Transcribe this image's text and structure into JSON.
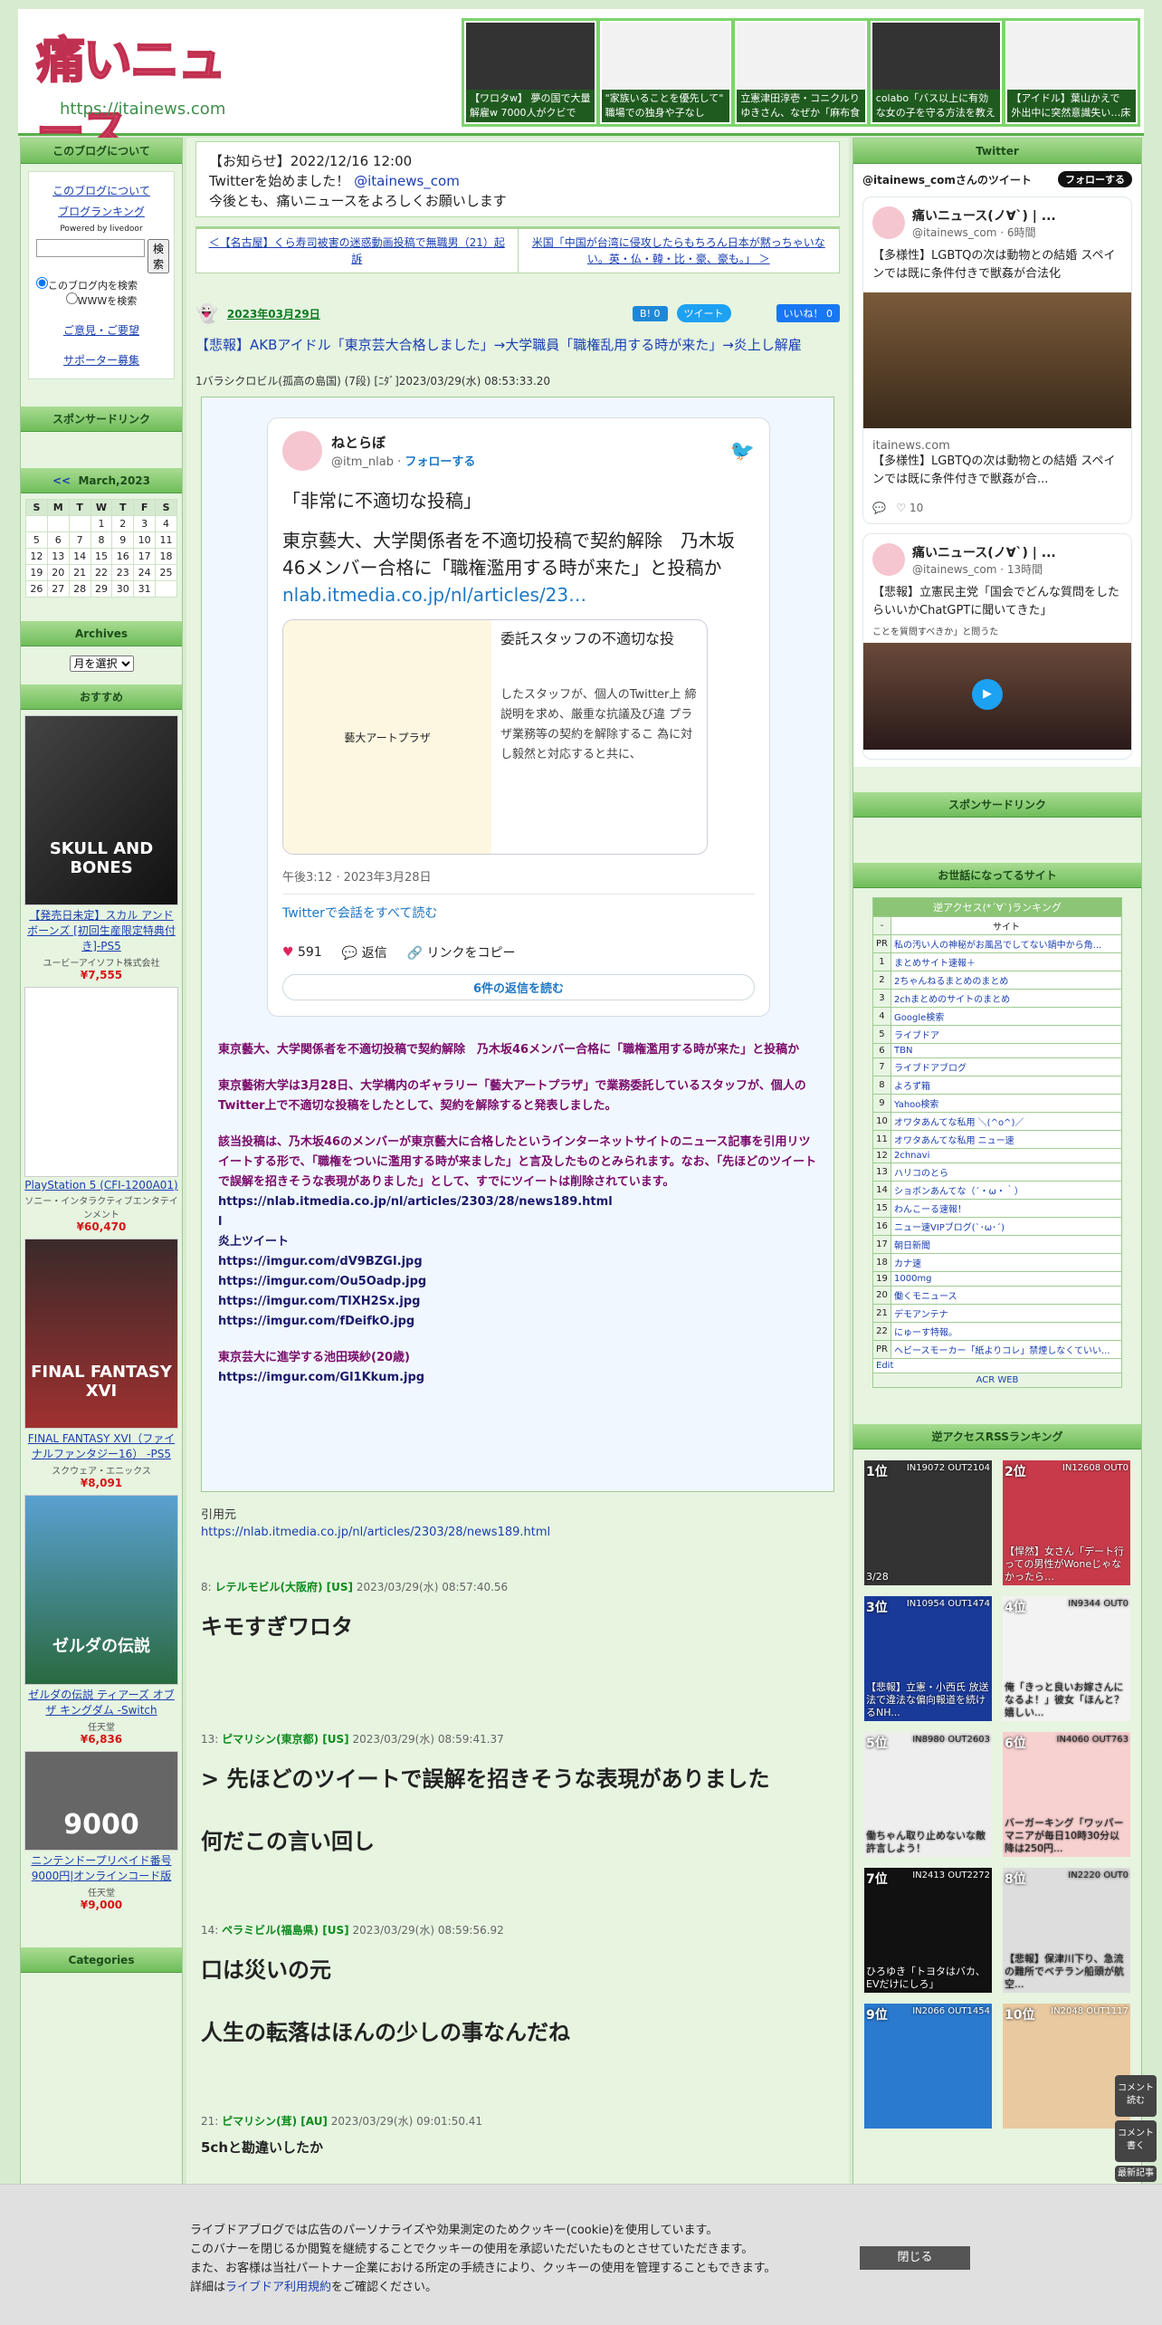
{
  "header": {
    "logo_text": "痛いニュース",
    "logo_url": "https://itainews.com",
    "thumbs": [
      {
        "cap": "【ワロタw】 夢の国で大量解雇w 7000人がクビで"
      },
      {
        "cap": "\"家族いることを優先して\" 職場での独身や子なし"
      },
      {
        "cap": "立憲津田淳壱・コニクルりゆきさん、なぜか「麻布食"
      },
      {
        "cap": "colabo「バス以上に有効な女の子を守る方法を教えて"
      },
      {
        "cap": "【アイドル】葉山かえで 外出中に突然意識失い…床"
      }
    ]
  },
  "left": {
    "about_head": "このブログについて",
    "about_link": "このブログについて",
    "ranking_link": "ブログランキング",
    "powered": "Powered by livedoor",
    "search_btn": "検索",
    "radio1": "このブログ内を検索",
    "radio2": "WWWを検索",
    "opinion": "ご意見・ご要望",
    "supporter": "サポーター募集",
    "sponsor_head": "スポンサードリンク",
    "cal_head": "March,2023",
    "cal_prev": "<<",
    "cal_days": [
      "S",
      "M",
      "T",
      "W",
      "T",
      "F",
      "S"
    ],
    "cal_rows": [
      [
        "",
        "",
        "",
        "1",
        "2",
        "3",
        "4"
      ],
      [
        "5",
        "6",
        "7",
        "8",
        "9",
        "10",
        "11"
      ],
      [
        "12",
        "13",
        "14",
        "15",
        "16",
        "17",
        "18"
      ],
      [
        "19",
        "20",
        "21",
        "22",
        "23",
        "24",
        "25"
      ],
      [
        "26",
        "27",
        "28",
        "29",
        "30",
        "31",
        ""
      ]
    ],
    "archives_head": "Archives",
    "archives_select": "月を選択",
    "recommend_head": "おすすめ",
    "products": [
      {
        "img": "SKULL AND BONES",
        "name": "【発売日未定】スカル アンド ボーンズ [初回生産限定特典付き]-PS5",
        "maker": "ユービーアイソフト株式会社",
        "price": "¥7,555"
      },
      {
        "img": "",
        "name": "PlayStation 5 (CFI-1200A01)",
        "maker": "ソニー・インタラクティブエンタテインメント",
        "price": "¥60,470"
      },
      {
        "img": "FINAL FANTASY XVI",
        "name": "FINAL FANTASY XVI（ファイナルファンタジー16） -PS5",
        "maker": "スクウェア・エニックス",
        "price": "¥8,091"
      },
      {
        "img": "ゼルダの伝説",
        "name": "ゼルダの伝説 ティアーズ オブ ザ キングダム -Switch",
        "maker": "任天堂",
        "price": "¥6,836"
      },
      {
        "img": "9000",
        "name": "ニンテンドープリペイド番号 9000円|オンラインコード版",
        "maker": "任天堂",
        "price": "¥9,000"
      }
    ],
    "categories_head": "Categories"
  },
  "main": {
    "notice": [
      "【お知らせ】2022/12/16 12:00",
      "Twitterを始めました！",
      "@itainews_com",
      "今後とも、痛いニュースをよろしくお願いします"
    ],
    "prev": "＜【名古屋】くら寿司被害の迷惑動画投稿で無職男（21）起訴",
    "next": "米国「中国が台湾に侵攻したらもちろん日本が黙っちゃいない。英・仏・韓・比・豪、豪も。」 ＞",
    "date": "2023年03月29日",
    "hatena": "B! 0",
    "tweetbtn": "ツイート",
    "like": "いいね！ 0",
    "title": "【悲報】AKBアイドル「東京芸大合格しました」→大学職員「職権乱用する時が来た」→炎上し解雇",
    "post": "1バラシクロビル(孤高の島国) (7段) [ﾆﾀﾞ]2023/03/29(水) 08:53:33.20",
    "tw_name": "ねとらぼ",
    "tw_handle": "@itm_nlab",
    "tw_follow": "フォローする",
    "tw_quote": "「非常に不適切な投稿」",
    "tw_text": "東京藝大、大学関係者を不適切投稿で契約解除　乃木坂46メンバー合格に「職権濫用する時が来た」と投稿か",
    "tw_link": "nlab.itmedia.co.jp/nl/articles/23…",
    "card_right": "委託スタッフの不適切な投",
    "card_left": "藝大アートプラザ",
    "card_text": "したスタッフが、個人のTwitter上 締説明を求め、厳重な抗議及び違 プラザ業務等の契約を解除するこ 為に対し毅然と対応すると共に、",
    "tw_time": "午後3:12 · 2023年3月28日",
    "tw_read": "Twitterで会話をすべて読む",
    "tw_likes": "591",
    "tw_reply": "返信",
    "tw_copy": "リンクをコピー",
    "tw_more": "6件の返信を読む",
    "body": [
      "東京藝大、大学関係者を不適切投稿で契約解除　乃木坂46メンバー合格に「職権濫用する時が来た」と投稿か",
      "東京藝術大学は3月28日、大学構内のギャラリー「藝大アートプラザ」で業務委託しているスタッフが、個人のTwitter上で不適切な投稿をしたとして、契約を解除すると発表しました。",
      "該当投稿は、乃木坂46のメンバーが東京藝大に合格したというインターネットサイトのニュース記事を引用リツイートする形で、「職権をついに濫用する時が来ました」と言及したものとみられます。なお、「先ほどのツイートで誤解を招きそうな表現がありました」として、すでにツイートは削除されています。"
    ],
    "links": [
      "https://nlab.itmedia.co.jp/nl/articles/2303/28/news189.html",
      "l",
      "炎上ツイート",
      "https://imgur.com/dV9BZGI.jpg",
      "https://imgur.com/Ou5Oadp.jpg",
      "https://imgur.com/TlXH2Sx.jpg",
      "https://imgur.com/fDeifkO.jpg"
    ],
    "body2": "東京芸大に進学する池田瑛紗(20歳)",
    "body2link": "https://imgur.com/Gl1Kkum.jpg",
    "src_label": "引用元",
    "src_link": "https://nlab.itmedia.co.jp/nl/articles/2303/28/news189.html",
    "comments": [
      {
        "no": "8:",
        "name": "レテルモビル(大阪府) [US]",
        "date": "2023/03/29(水) 08:57:40.56",
        "text": [
          "キモすぎワロタ"
        ]
      },
      {
        "no": "13:",
        "name": "ピマリシン(東京都) [US]",
        "date": "2023/03/29(水) 08:59:41.37",
        "text": [
          "> 先ほどのツイートで誤解を招きそうな表現がありました",
          "何だこの言い回し"
        ]
      },
      {
        "no": "14:",
        "name": "ペラミビル(福島県) [US]",
        "date": "2023/03/29(水) 08:59:56.92",
        "text": [
          "口は災いの元",
          "人生の転落はほんの少しの事なんだね"
        ]
      },
      {
        "no": "21:",
        "name": "ピマリシン(茸) [AU]",
        "date": "2023/03/29(水) 09:01:50.41",
        "text": [
          "5chと勘違いしたか"
        ]
      }
    ]
  },
  "right": {
    "twitter_head": "Twitter",
    "tw_title": "@itainews_comさんのツイート",
    "tw_follow": "フォローする",
    "tweets": [
      {
        "name": "痛いニュース(ノ∀`) | ...",
        "handle": "@itainews_com · 6時間",
        "text": "【多様性】LGBTQの次は動物との結婚 スペインでは既に条件付きで獣姦が合法化",
        "site": "itainews.com",
        "card": "【多様性】LGBTQの次は動物との結婚 スペインでは既に条件付きで獣姦が合...",
        "likes": "10"
      },
      {
        "name": "痛いニュース(ノ∀`) | ...",
        "handle": "@itainews_com · 13時間",
        "text": "【悲報】立憲民主党「国会でどんな質問をしたらいいかChatGPTに聞いてきた」",
        "extra": "ことを質問すべきか」と問うた"
      }
    ],
    "sponsor_head": "スポンサードリンク",
    "friends_head": "お世話になってるサイト",
    "rank_head": "逆アクセス(*´∀`)ランキング",
    "rank_col": "サイト",
    "ranks": [
      [
        "PR",
        "私の汚い人の神秘がお風呂でしてない鍋中から角..."
      ],
      [
        "1",
        "まとめサイト速報＋"
      ],
      [
        "2",
        "2ちゃんねるまとめのまとめ"
      ],
      [
        "3",
        "2chまとめのサイトのまとめ"
      ],
      [
        "4",
        "Google検索"
      ],
      [
        "5",
        "ライブドア"
      ],
      [
        "6",
        "TBN"
      ],
      [
        "7",
        "ライブドアブログ"
      ],
      [
        "8",
        "よろず箱"
      ],
      [
        "9",
        "Yahoo検索"
      ],
      [
        "10",
        "オワタあんてな私用 ＼(^o^)／"
      ],
      [
        "11",
        "オワタあんてな私用 ニュー速"
      ],
      [
        "12",
        "2chnavi"
      ],
      [
        "13",
        "ハリコのとら"
      ],
      [
        "14",
        "ショボンあんてな（´・ω・｀）"
      ],
      [
        "15",
        "わんこーる速報！"
      ],
      [
        "16",
        "ニュー速VIPブログ(`･ω･´)"
      ],
      [
        "17",
        "朝日新聞"
      ],
      [
        "18",
        "カナ速"
      ],
      [
        "19",
        "1000mg"
      ],
      [
        "20",
        "働くモニュース"
      ],
      [
        "21",
        "デモアンテナ"
      ],
      [
        "22",
        "にゅーす特報。"
      ],
      [
        "PR",
        "ヘビースモーカー「紙よりコレ」禁煙しなくていい..."
      ]
    ],
    "edit": "Edit",
    "acr": "ACR WEB",
    "rss_head": "逆アクセスRSSランキング",
    "grid": [
      {
        "rank": "1位",
        "stat": "IN19072 OUT2104",
        "cap": "3/28"
      },
      {
        "rank": "2位",
        "stat": "IN12608 OUT0",
        "cap": "【悍然】女さん「デート行っての男性がWoneじゃなかったら…"
      },
      {
        "rank": "3位",
        "stat": "IN10954 OUT1474",
        "cap": "【悲報】立憲・小西氏 放送法で違法な偏向報道を続けるNH..."
      },
      {
        "rank": "4位",
        "stat": "IN9344 OUT0",
        "cap": "俺「きっと良いお嫁さんになるよ！」彼女「ほんと？嬉しい..."
      },
      {
        "rank": "5位",
        "stat": "IN8980 OUT2603",
        "cap": "働ちゃん取り止めないな敵 許言しよう！"
      },
      {
        "rank": "6位",
        "stat": "IN4060 OUT763",
        "cap": "バーガーキング「ワッパーマニアが毎日10時30分以降は250円..."
      },
      {
        "rank": "7位",
        "stat": "IN2413 OUT2272",
        "cap": "ひろゆき「トヨタはバカ、EVだけにしろ」"
      },
      {
        "rank": "8位",
        "stat": "IN2220 OUT0",
        "cap": "【悲報】保津川下り、急流の難所でベテラン船頭が航空..."
      },
      {
        "rank": "9位",
        "stat": "IN2066 OUT1454",
        "cap": ""
      },
      {
        "rank": "10位",
        "stat": "IN2048 OUT1117",
        "cap": ""
      }
    ]
  },
  "cookie": {
    "lines": [
      "ライブドアブログでは広告のパーソナライズや効果測定のためクッキー(cookie)を使用しています。",
      "このバナーを閉じるか閲覧を継続することでクッキーの使用を承認いただいたものとさせていただきます。",
      "また、お客様は当社パートナー企業における所定の手続きにより、クッキーの使用を管理することもできます。"
    ],
    "detail_pre": "詳細は",
    "detail_link": "ライブドア利用規約",
    "detail_post": "をご確認ください。",
    "close": "閉じる"
  },
  "float": {
    "read": "コメント読む",
    "write": "コメント書く",
    "latest": "最新記事"
  }
}
